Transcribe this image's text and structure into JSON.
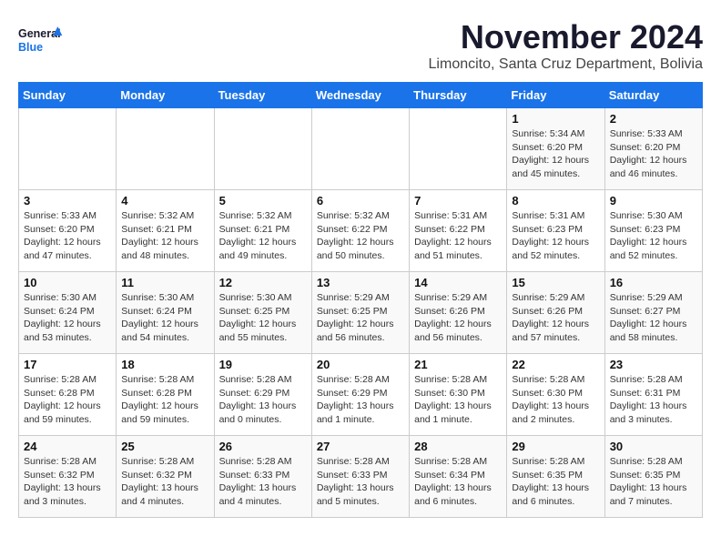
{
  "logo": {
    "line1": "General",
    "line2": "Blue"
  },
  "title": "November 2024",
  "location": "Limoncito, Santa Cruz Department, Bolivia",
  "weekdays": [
    "Sunday",
    "Monday",
    "Tuesday",
    "Wednesday",
    "Thursday",
    "Friday",
    "Saturday"
  ],
  "weeks": [
    [
      {
        "day": "",
        "info": ""
      },
      {
        "day": "",
        "info": ""
      },
      {
        "day": "",
        "info": ""
      },
      {
        "day": "",
        "info": ""
      },
      {
        "day": "",
        "info": ""
      },
      {
        "day": "1",
        "info": "Sunrise: 5:34 AM\nSunset: 6:20 PM\nDaylight: 12 hours\nand 45 minutes."
      },
      {
        "day": "2",
        "info": "Sunrise: 5:33 AM\nSunset: 6:20 PM\nDaylight: 12 hours\nand 46 minutes."
      }
    ],
    [
      {
        "day": "3",
        "info": "Sunrise: 5:33 AM\nSunset: 6:20 PM\nDaylight: 12 hours\nand 47 minutes."
      },
      {
        "day": "4",
        "info": "Sunrise: 5:32 AM\nSunset: 6:21 PM\nDaylight: 12 hours\nand 48 minutes."
      },
      {
        "day": "5",
        "info": "Sunrise: 5:32 AM\nSunset: 6:21 PM\nDaylight: 12 hours\nand 49 minutes."
      },
      {
        "day": "6",
        "info": "Sunrise: 5:32 AM\nSunset: 6:22 PM\nDaylight: 12 hours\nand 50 minutes."
      },
      {
        "day": "7",
        "info": "Sunrise: 5:31 AM\nSunset: 6:22 PM\nDaylight: 12 hours\nand 51 minutes."
      },
      {
        "day": "8",
        "info": "Sunrise: 5:31 AM\nSunset: 6:23 PM\nDaylight: 12 hours\nand 52 minutes."
      },
      {
        "day": "9",
        "info": "Sunrise: 5:30 AM\nSunset: 6:23 PM\nDaylight: 12 hours\nand 52 minutes."
      }
    ],
    [
      {
        "day": "10",
        "info": "Sunrise: 5:30 AM\nSunset: 6:24 PM\nDaylight: 12 hours\nand 53 minutes."
      },
      {
        "day": "11",
        "info": "Sunrise: 5:30 AM\nSunset: 6:24 PM\nDaylight: 12 hours\nand 54 minutes."
      },
      {
        "day": "12",
        "info": "Sunrise: 5:30 AM\nSunset: 6:25 PM\nDaylight: 12 hours\nand 55 minutes."
      },
      {
        "day": "13",
        "info": "Sunrise: 5:29 AM\nSunset: 6:25 PM\nDaylight: 12 hours\nand 56 minutes."
      },
      {
        "day": "14",
        "info": "Sunrise: 5:29 AM\nSunset: 6:26 PM\nDaylight: 12 hours\nand 56 minutes."
      },
      {
        "day": "15",
        "info": "Sunrise: 5:29 AM\nSunset: 6:26 PM\nDaylight: 12 hours\nand 57 minutes."
      },
      {
        "day": "16",
        "info": "Sunrise: 5:29 AM\nSunset: 6:27 PM\nDaylight: 12 hours\nand 58 minutes."
      }
    ],
    [
      {
        "day": "17",
        "info": "Sunrise: 5:28 AM\nSunset: 6:28 PM\nDaylight: 12 hours\nand 59 minutes."
      },
      {
        "day": "18",
        "info": "Sunrise: 5:28 AM\nSunset: 6:28 PM\nDaylight: 12 hours\nand 59 minutes."
      },
      {
        "day": "19",
        "info": "Sunrise: 5:28 AM\nSunset: 6:29 PM\nDaylight: 13 hours\nand 0 minutes."
      },
      {
        "day": "20",
        "info": "Sunrise: 5:28 AM\nSunset: 6:29 PM\nDaylight: 13 hours\nand 1 minute."
      },
      {
        "day": "21",
        "info": "Sunrise: 5:28 AM\nSunset: 6:30 PM\nDaylight: 13 hours\nand 1 minute."
      },
      {
        "day": "22",
        "info": "Sunrise: 5:28 AM\nSunset: 6:30 PM\nDaylight: 13 hours\nand 2 minutes."
      },
      {
        "day": "23",
        "info": "Sunrise: 5:28 AM\nSunset: 6:31 PM\nDaylight: 13 hours\nand 3 minutes."
      }
    ],
    [
      {
        "day": "24",
        "info": "Sunrise: 5:28 AM\nSunset: 6:32 PM\nDaylight: 13 hours\nand 3 minutes."
      },
      {
        "day": "25",
        "info": "Sunrise: 5:28 AM\nSunset: 6:32 PM\nDaylight: 13 hours\nand 4 minutes."
      },
      {
        "day": "26",
        "info": "Sunrise: 5:28 AM\nSunset: 6:33 PM\nDaylight: 13 hours\nand 4 minutes."
      },
      {
        "day": "27",
        "info": "Sunrise: 5:28 AM\nSunset: 6:33 PM\nDaylight: 13 hours\nand 5 minutes."
      },
      {
        "day": "28",
        "info": "Sunrise: 5:28 AM\nSunset: 6:34 PM\nDaylight: 13 hours\nand 6 minutes."
      },
      {
        "day": "29",
        "info": "Sunrise: 5:28 AM\nSunset: 6:35 PM\nDaylight: 13 hours\nand 6 minutes."
      },
      {
        "day": "30",
        "info": "Sunrise: 5:28 AM\nSunset: 6:35 PM\nDaylight: 13 hours\nand 7 minutes."
      }
    ]
  ]
}
